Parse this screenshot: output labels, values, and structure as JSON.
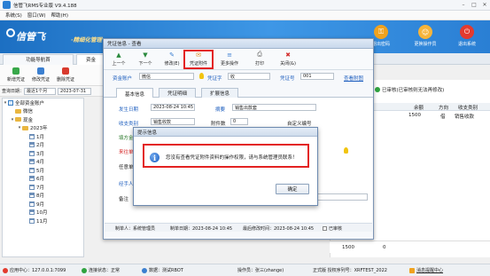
{
  "window": {
    "title": "信管飞RMS专业版 V9.4.188",
    "minimize": "–",
    "maximize": "□",
    "close": "✕"
  },
  "menu": [
    "系统(S)",
    "窗口(W)",
    "帮助(H)"
  ],
  "brand": {
    "name": "信管飞",
    "subtitle": "·精细化管理"
  },
  "top_buttons": [
    {
      "label": "退出密码",
      "icon": "key-icon",
      "color": "#f0a21e"
    },
    {
      "label": "更换操作员",
      "icon": "users-icon",
      "color": "#f7b43a"
    },
    {
      "label": "退出系统",
      "icon": "exit-icon",
      "color": "#e33a2e"
    }
  ],
  "tabs": [
    "功能导航首",
    "资金"
  ],
  "toolbar2": [
    "新增凭证",
    "修改凭证",
    "删除凭证"
  ],
  "query": {
    "label": "查询日期：",
    "range": "最近1个月",
    "date": "2023-07-31"
  },
  "tree": {
    "root": "全部资金账户",
    "nodes": [
      "微信",
      "现金"
    ],
    "year": "2023年",
    "months": [
      "1月",
      "2月",
      "3月",
      "4月",
      "5月",
      "6月",
      "7月",
      "8月",
      "9月",
      "10月",
      "11月"
    ]
  },
  "right_panel": {
    "legend": "已审核(已审核则无法再修改)",
    "headers": [
      "余额",
      "方向",
      "收支类别"
    ],
    "row": {
      "balance": "1500",
      "direction": "借",
      "category": "销售收款"
    },
    "total": "1500",
    "total_zero": "0"
  },
  "voucher": {
    "title": "凭证信息 - 查看",
    "toolbar": {
      "prev": "上一个",
      "next": "下一个",
      "edit": "修改(E)",
      "attach": "凭证附件",
      "more": "更多操作",
      "print": "打印",
      "close": "关闭(&)"
    },
    "account_label": "资金账户",
    "account_value": "微信",
    "voucher_word_label": "凭证字",
    "voucher_word_value": "收",
    "voucher_no_label": "凭证号",
    "voucher_no_value": "001",
    "attachment_link": "查看附图",
    "tabs": [
      "基本信息",
      "凭证明细",
      "扩展信息"
    ],
    "date_label": "发生日期",
    "date_value": "2023-08-24 10:45",
    "summary_label": "摘要",
    "summary_value": "销售出款套",
    "category_label": "收支类别",
    "category_value": "销售收款",
    "attachment_count_label": "附件数",
    "attachment_count_value": "0",
    "custom_label": "自定义编号",
    "amount_label": "填方金额",
    "counterparty_label": "来往单位",
    "business_label": "任意单",
    "handler_label": "经手人",
    "remark_label": "备注",
    "footer": {
      "creator": "制单人：系统管理员",
      "created": "制单日期：2023-08-24 10:45",
      "modified": "最后修改时间：2023-08-24 10:45",
      "checked": "已审核"
    }
  },
  "dialog": {
    "title": "提示信息",
    "message": "您没有查看凭证附件资料的操作权限，请与系统管理员联系！",
    "ok": "确定"
  },
  "status": {
    "app_center": "应用中心：127.0.0.1:7099",
    "connection": "连接状态：正常",
    "data_source": "数据：测试RBOT",
    "operator": "操作员：张三(zhange)",
    "license": "正式版 授权序列号：XRFTEST_2022",
    "message": "消息提醒中心"
  }
}
